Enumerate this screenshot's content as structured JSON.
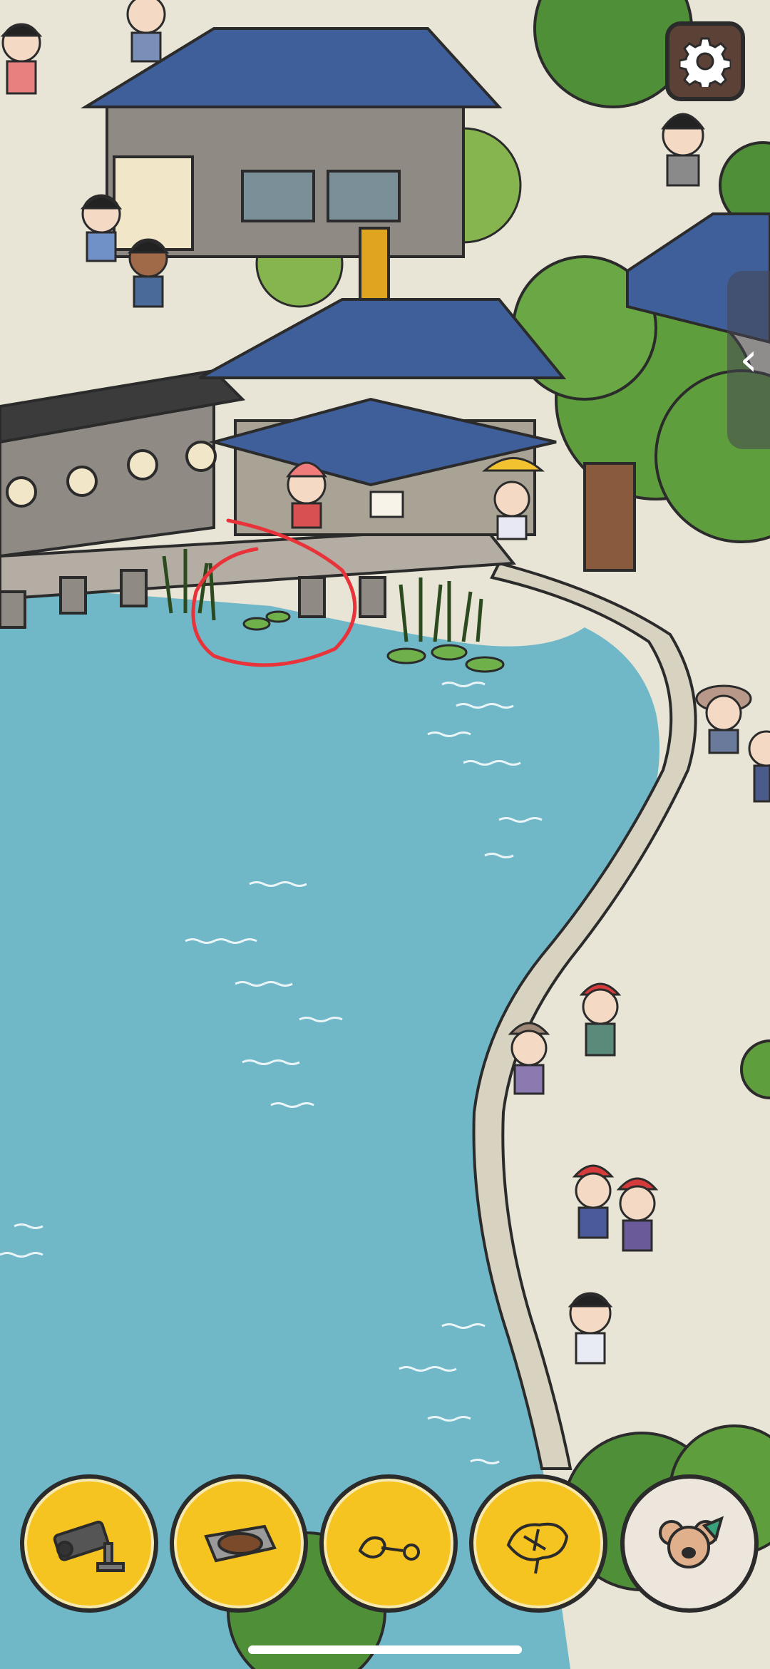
{
  "scene": {
    "name": "campus-lake-hidden-object",
    "colors": {
      "water": "#70b8c8",
      "ground": "#e8e4d6",
      "roof": "#3f5f9a",
      "tree": "#5f9e3d",
      "circle": "#e8333a",
      "button": "#f6c420"
    }
  },
  "settings": {
    "icon": "gear-icon"
  },
  "side_panel": {
    "label": "‹"
  },
  "toolbar": {
    "items": [
      {
        "icon": "security-camera-icon"
      },
      {
        "icon": "baking-tray-icon"
      },
      {
        "icon": "keychain-icon"
      },
      {
        "icon": "leaf-icon"
      },
      {
        "icon": "koala-avatar-icon"
      }
    ]
  }
}
